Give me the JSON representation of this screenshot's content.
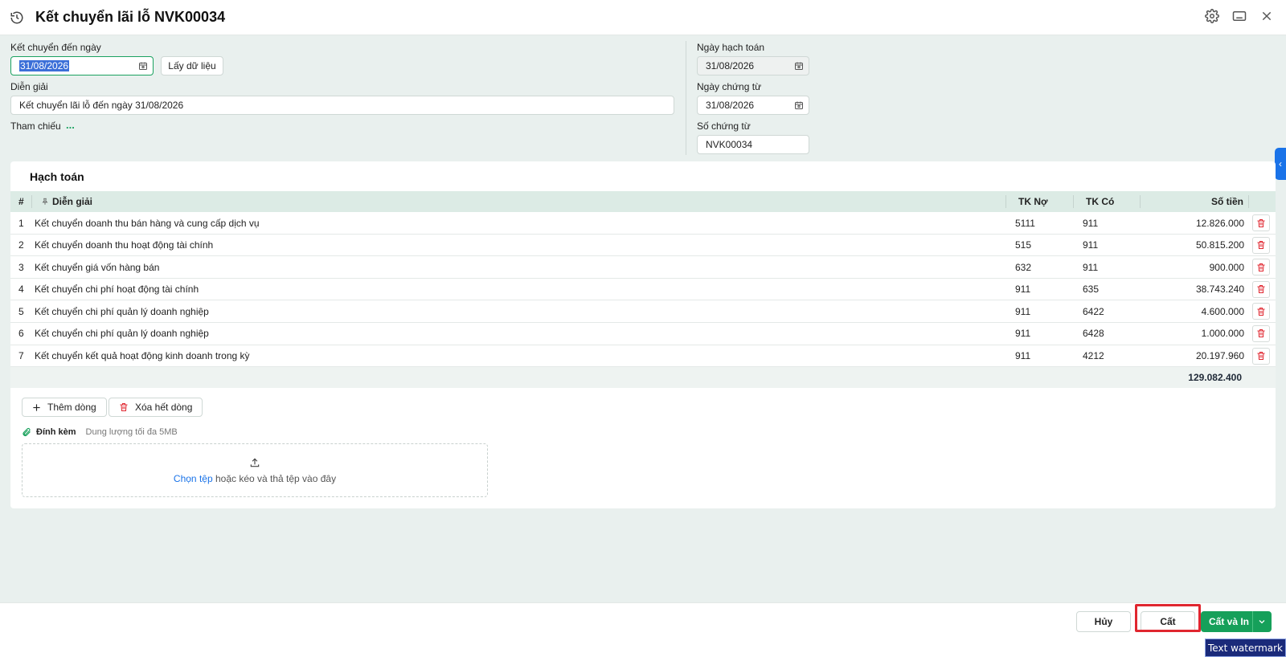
{
  "header": {
    "title": "Kết chuyển lãi lỗ NVK00034"
  },
  "form": {
    "ket_chuyen_label": "Kết chuyển đến ngày",
    "ket_chuyen_value": "31/08/2026",
    "lay_du_lieu": "Lấy dữ liệu",
    "dien_giai_label": "Diễn giải",
    "dien_giai_value": "Kết chuyển lãi lỗ đến ngày 31/08/2026",
    "tham_chieu_label": "Tham chiếu",
    "tham_chieu_dots": "...",
    "ngay_hach_toan_label": "Ngày hạch toán",
    "ngay_hach_toan_value": "31/08/2026",
    "ngay_chung_tu_label": "Ngày chứng từ",
    "ngay_chung_tu_value": "31/08/2026",
    "so_chung_tu_label": "Số chứng từ",
    "so_chung_tu_value": "NVK00034"
  },
  "panel": {
    "title": "Hạch toán",
    "columns": {
      "index": "#",
      "dien_giai": "Diễn giải",
      "tk_no": "TK Nợ",
      "tk_co": "TK Có",
      "so_tien": "Số tiền"
    },
    "rows": [
      {
        "idx": "1",
        "desc": "Kết chuyển doanh thu bán hàng và cung cấp dịch vụ",
        "tk_no": "5111",
        "tk_co": "911",
        "amount": "12.826.000"
      },
      {
        "idx": "2",
        "desc": "Kết chuyển doanh thu hoạt động tài chính",
        "tk_no": "515",
        "tk_co": "911",
        "amount": "50.815.200"
      },
      {
        "idx": "3",
        "desc": "Kết chuyển giá vốn hàng bán",
        "tk_no": "632",
        "tk_co": "911",
        "amount": "900.000"
      },
      {
        "idx": "4",
        "desc": "Kết chuyển chi phí hoạt động tài chính",
        "tk_no": "911",
        "tk_co": "635",
        "amount": "38.743.240"
      },
      {
        "idx": "5",
        "desc": "Kết chuyển chi phí quản lý doanh nghiệp",
        "tk_no": "911",
        "tk_co": "6422",
        "amount": "4.600.000"
      },
      {
        "idx": "6",
        "desc": "Kết chuyển chi phí quản lý doanh nghiệp",
        "tk_no": "911",
        "tk_co": "6428",
        "amount": "1.000.000"
      },
      {
        "idx": "7",
        "desc": "Kết chuyển kết quả hoạt động kinh doanh trong kỳ",
        "tk_no": "911",
        "tk_co": "4212",
        "amount": "20.197.960"
      }
    ],
    "total": "129.082.400",
    "them_dong": "Thêm dòng",
    "xoa_het_dong": "Xóa hết dòng",
    "dinh_kem": "Đính kèm",
    "dung_luong": "Dung lượng tối đa 5MB",
    "chon_tep": "Chọn tệp",
    "keo_tha": "hoặc kéo và thả tệp vào đây"
  },
  "footer": {
    "huy": "Hủy",
    "cat": "Cất",
    "cat_va_in": "Cất và In"
  },
  "watermark": "Text watermark",
  "colors": {
    "accent": "#16a05a",
    "link": "#1a73e8",
    "danger": "#e0262f",
    "background": "#e9f0ee"
  }
}
